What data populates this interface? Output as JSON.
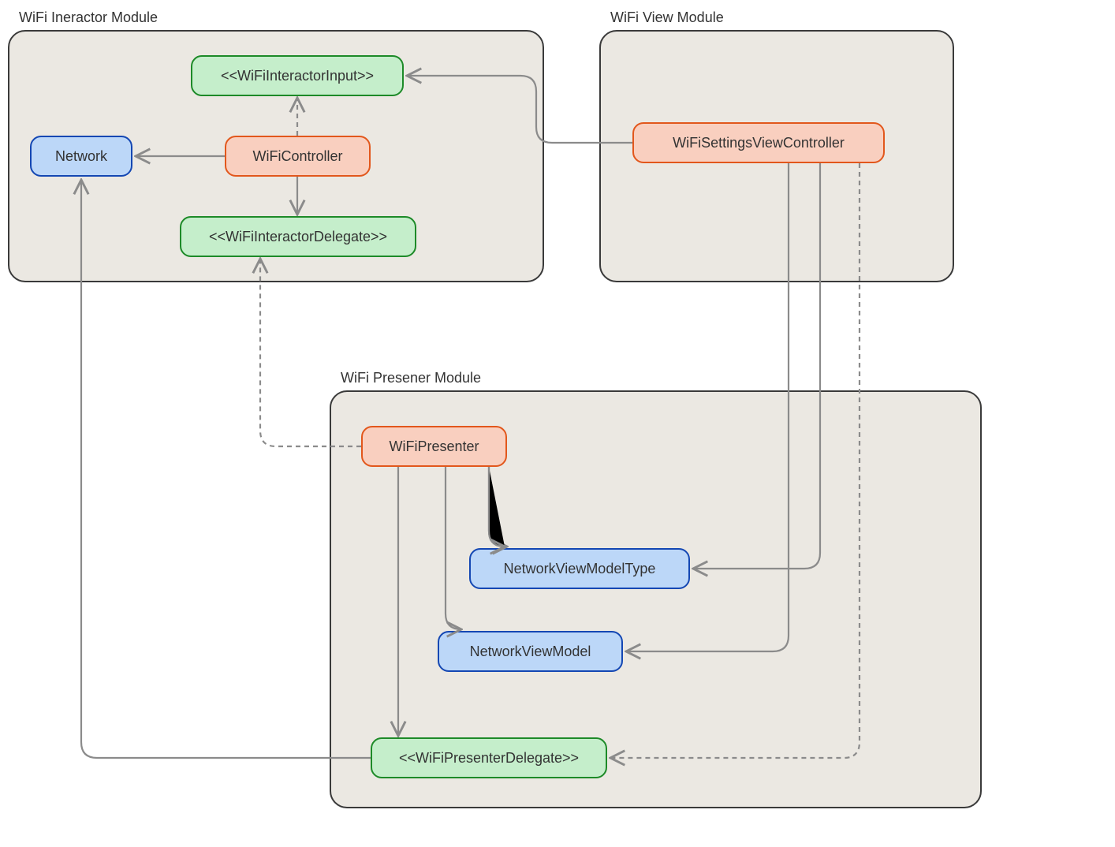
{
  "modules": {
    "interactor": {
      "label": "WiFi Ineractor Module"
    },
    "view": {
      "label": "WiFi View Module"
    },
    "presenter": {
      "label": "WiFi Presener Module"
    }
  },
  "nodes": {
    "interactorInput": "<<WiFiInteractorInput>>",
    "controller": "WiFiController",
    "network": "Network",
    "interactorDelegate": "<<WiFiInteractorDelegate>>",
    "settingsVC": "WiFiSettingsViewController",
    "wifiPresenter": "WiFiPresenter",
    "networkVMType": "NetworkViewModelType",
    "networkVM": "NetworkViewModel",
    "presenterDelegate": "<<WiFiPresenterDelegate>>"
  }
}
